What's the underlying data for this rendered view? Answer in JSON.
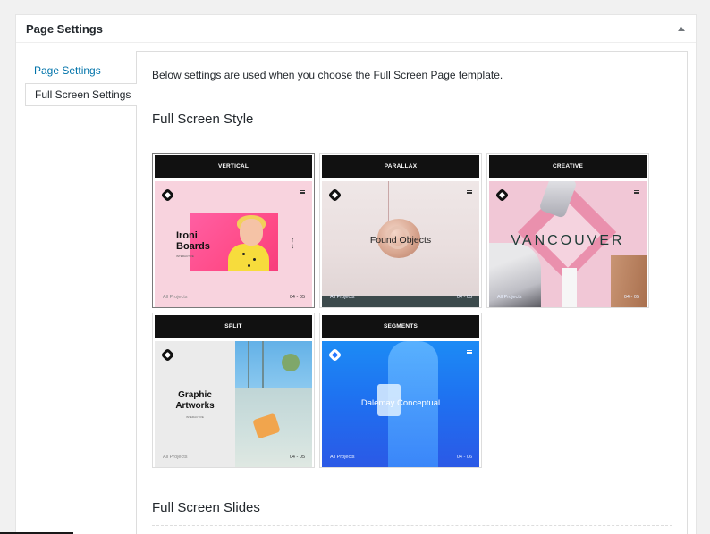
{
  "metabox": {
    "title": "Page Settings"
  },
  "tabs": [
    {
      "label": "Page Settings"
    },
    {
      "label": "Full Screen Settings"
    }
  ],
  "panel": {
    "intro": "Below settings are used when you choose the Full Screen Page template.",
    "style_heading": "Full Screen Style",
    "slides_heading": "Full Screen Slides"
  },
  "styles": [
    {
      "label": "VERTICAL",
      "title_line1": "Ironi",
      "title_line2": "Boards",
      "subtitle": "INTERACTIVE",
      "footer_left": "All Projects",
      "footer_right": "04 - 05",
      "selected": true
    },
    {
      "label": "PARALLAX",
      "title": "Found Objects",
      "footer_left": "All Projects",
      "footer_right": "04 - 05",
      "selected": false
    },
    {
      "label": "CREATIVE",
      "title": "VANCOUVER",
      "footer_left": "All Projects",
      "footer_right": "04 - 05",
      "selected": false
    },
    {
      "label": "SPLIT",
      "title_line1": "Graphic",
      "title_line2": "Artworks",
      "subtitle": "INTERACTIVE",
      "footer_left": "All Projects",
      "footer_right": "04 - 05",
      "selected": false
    },
    {
      "label": "SEGMENTS",
      "title": "Dalemay Conceptual",
      "footer_left": "All Projects",
      "footer_right": "04 - 06",
      "selected": false
    }
  ],
  "colors": {
    "link": "#0073aa",
    "accent_pink": "#ff4b88",
    "segments_blue": "#1f6ff0"
  }
}
